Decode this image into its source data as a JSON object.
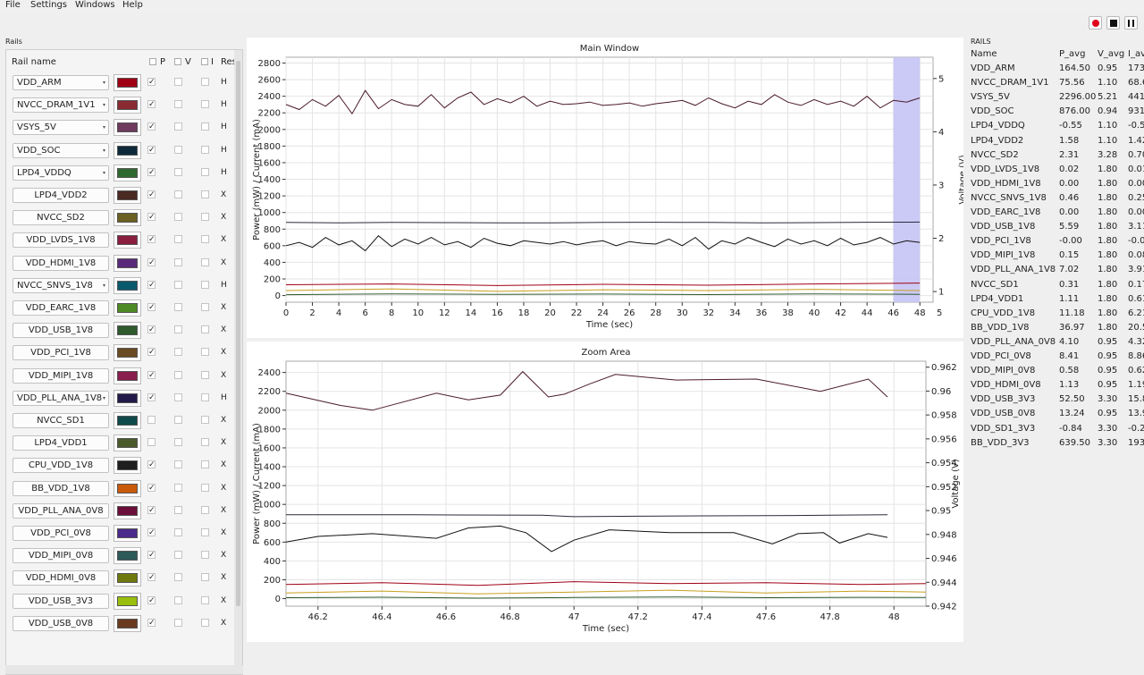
{
  "menu": [
    "File",
    "Settings",
    "Windows",
    "Help"
  ],
  "toolbar": {
    "buttons": [
      "record",
      "stop",
      "pause"
    ]
  },
  "rails_panel": {
    "title": "Rails",
    "headers": {
      "name": "Rail name",
      "p": "P",
      "v": "V",
      "i": "I",
      "res": "Res"
    },
    "rows": [
      {
        "name": "VDD_ARM",
        "dropdown": true,
        "color": "#a00014",
        "p": true,
        "res": "H"
      },
      {
        "name": "NVCC_DRAM_1V1",
        "dropdown": true,
        "color": "#8a2a32",
        "p": true,
        "res": "H"
      },
      {
        "name": "VSYS_5V",
        "dropdown": true,
        "color": "#6e3a5e",
        "p": true,
        "res": "H"
      },
      {
        "name": "VDD_SOC",
        "dropdown": true,
        "color": "#0e2a3a",
        "p": true,
        "res": "H"
      },
      {
        "name": "LPD4_VDDQ",
        "dropdown": true,
        "color": "#2e6a30",
        "p": true,
        "res": "H"
      },
      {
        "name": "LPD4_VDD2",
        "dropdown": false,
        "color": "#4a2a22",
        "p": true,
        "res": "X"
      },
      {
        "name": "NVCC_SD2",
        "dropdown": false,
        "color": "#6b5f22",
        "p": true,
        "res": "X"
      },
      {
        "name": "VDD_LVDS_1V8",
        "dropdown": false,
        "color": "#8a1e3e",
        "p": true,
        "res": "X"
      },
      {
        "name": "VDD_HDMI_1V8",
        "dropdown": false,
        "color": "#5a2a7a",
        "p": true,
        "res": "X"
      },
      {
        "name": "NVCC_SNVS_1V8",
        "dropdown": true,
        "color": "#0a5a6e",
        "p": true,
        "res": "H"
      },
      {
        "name": "VDD_EARC_1V8",
        "dropdown": false,
        "color": "#4e8a26",
        "p": true,
        "res": "X"
      },
      {
        "name": "VDD_USB_1V8",
        "dropdown": false,
        "color": "#2e5a2e",
        "p": true,
        "res": "X"
      },
      {
        "name": "VDD_PCI_1V8",
        "dropdown": false,
        "color": "#6a4a22",
        "p": true,
        "res": "X"
      },
      {
        "name": "VDD_MIPI_1V8",
        "dropdown": false,
        "color": "#8a1e4e",
        "p": true,
        "res": "X"
      },
      {
        "name": "VDD_PLL_ANA_1V8",
        "dropdown": true,
        "color": "#241a4a",
        "p": true,
        "res": "H"
      },
      {
        "name": "NVCC_SD1",
        "dropdown": false,
        "color": "#0e4a4a",
        "p": false,
        "res": "X"
      },
      {
        "name": "LPD4_VDD1",
        "dropdown": false,
        "color": "#4a5a2a",
        "p": false,
        "res": "X"
      },
      {
        "name": "CPU_VDD_1V8",
        "dropdown": false,
        "color": "#1e1e1e",
        "p": true,
        "res": "X"
      },
      {
        "name": "BB_VDD_1V8",
        "dropdown": false,
        "color": "#c85a0a",
        "p": true,
        "res": "X"
      },
      {
        "name": "VDD_PLL_ANA_0V8",
        "dropdown": false,
        "color": "#6a0e3a",
        "p": true,
        "res": "X"
      },
      {
        "name": "VDD_PCI_0V8",
        "dropdown": false,
        "color": "#4a2a8a",
        "p": true,
        "res": "X"
      },
      {
        "name": "VDD_MIPI_0V8",
        "dropdown": false,
        "color": "#2e5a5a",
        "p": true,
        "res": "X"
      },
      {
        "name": "VDD_HDMI_0V8",
        "dropdown": false,
        "color": "#6e7a0e",
        "p": true,
        "res": "X"
      },
      {
        "name": "VDD_USB_3V3",
        "dropdown": false,
        "color": "#9abe0e",
        "p": true,
        "res": "X"
      },
      {
        "name": "VDD_USB_0V8",
        "dropdown": false,
        "color": "#6a3a1e",
        "p": true,
        "res": "X"
      }
    ]
  },
  "main_chart": {
    "title": "Main Window",
    "xlabel": "Time (sec)",
    "ylabel": "Power (mW) / Current (mA)",
    "y2label": "Voltage (V)",
    "xticks": [
      "0",
      "2",
      "4",
      "6",
      "8",
      "10",
      "12",
      "14",
      "16",
      "18",
      "20",
      "22",
      "24",
      "26",
      "28",
      "30",
      "32",
      "34",
      "36",
      "38",
      "40",
      "42",
      "44",
      "46",
      "48"
    ],
    "yticks": [
      "0",
      "200",
      "400",
      "600",
      "800",
      "1000",
      "1200",
      "1400",
      "1600",
      "1800",
      "2000",
      "2200",
      "2400",
      "2600",
      "2800"
    ],
    "y2ticks": [
      "1",
      "2",
      "3",
      "4",
      "5"
    ],
    "x2_edge_tick": "5"
  },
  "zoom_chart": {
    "title": "Zoom Area",
    "xlabel": "Time (sec)",
    "ylabel": "Power (mW) / Current (mA)",
    "y2label": "Voltage (V)",
    "xticks": [
      "46.2",
      "46.4",
      "46.6",
      "46.8",
      "47",
      "47.2",
      "47.4",
      "47.6",
      "47.8",
      "48"
    ],
    "yticks": [
      "0",
      "200",
      "400",
      "600",
      "800",
      "1000",
      "1200",
      "1400",
      "1600",
      "1800",
      "2000",
      "2200",
      "2400"
    ],
    "y2ticks": [
      "0.942",
      "0.944",
      "0.946",
      "0.948",
      "0.95",
      "0.952",
      "0.954",
      "0.956",
      "0.958",
      "0.96",
      "0.962"
    ]
  },
  "chart_data": [
    {
      "type": "line",
      "title": "Main Window",
      "xlabel": "Time (sec)",
      "ylabel": "Power (mW) / Current (mA)",
      "y2label": "Voltage (V)",
      "xlim": [
        0,
        49
      ],
      "ylim": [
        -80,
        2870
      ],
      "y2lim": [
        0.8,
        5.4
      ],
      "grid": true,
      "highlight_region": [
        46,
        48
      ],
      "series": [
        {
          "x": [
            0,
            1,
            2,
            3,
            4,
            5,
            6,
            7,
            8,
            9,
            10,
            11,
            12,
            13,
            14,
            15,
            16,
            17,
            18,
            19,
            20,
            21,
            22,
            23,
            24,
            25,
            26,
            27,
            28,
            29,
            30,
            31,
            32,
            33,
            34,
            35,
            36,
            37,
            38,
            39,
            40,
            41,
            42,
            43,
            44,
            45,
            46,
            47,
            48
          ],
          "values": [
            2300,
            2240,
            2360,
            2280,
            2410,
            2190,
            2470,
            2250,
            2360,
            2300,
            2280,
            2420,
            2260,
            2380,
            2450,
            2300,
            2370,
            2320,
            2400,
            2280,
            2340,
            2300,
            2310,
            2330,
            2290,
            2300,
            2320,
            2280,
            2310,
            2330,
            2350,
            2290,
            2380,
            2310,
            2260,
            2340,
            2300,
            2420,
            2330,
            2290,
            2360,
            2300,
            2340,
            2280,
            2400,
            2260,
            2350,
            2330,
            2380
          ]
        },
        {
          "x": [
            0,
            4,
            8,
            12,
            16,
            20,
            24,
            28,
            32,
            36,
            40,
            44,
            48
          ],
          "values": [
            880,
            875,
            880,
            878,
            876,
            875,
            880,
            882,
            880,
            876,
            878,
            882,
            885
          ]
        },
        {
          "x": [
            0,
            1,
            2,
            3,
            4,
            5,
            6,
            7,
            8,
            9,
            10,
            11,
            12,
            13,
            14,
            15,
            16,
            17,
            18,
            19,
            20,
            21,
            22,
            23,
            24,
            25,
            26,
            27,
            28,
            29,
            30,
            31,
            32,
            33,
            34,
            35,
            36,
            37,
            38,
            39,
            40,
            41,
            42,
            43,
            44,
            45,
            46,
            47,
            48
          ],
          "values": [
            600,
            640,
            580,
            700,
            610,
            660,
            540,
            720,
            590,
            680,
            620,
            700,
            610,
            650,
            580,
            690,
            630,
            600,
            660,
            640,
            620,
            650,
            610,
            640,
            660,
            600,
            650,
            630,
            620,
            680,
            600,
            700,
            560,
            660,
            620,
            700,
            640,
            590,
            680,
            620,
            660,
            600,
            690,
            610,
            640,
            700,
            620,
            660,
            640
          ]
        },
        {
          "x": [
            0,
            8,
            16,
            24,
            32,
            40,
            48
          ],
          "values": [
            130,
            140,
            120,
            135,
            125,
            140,
            150
          ]
        },
        {
          "x": [
            0,
            8,
            16,
            24,
            32,
            40,
            48
          ],
          "values": [
            60,
            80,
            50,
            70,
            60,
            75,
            60
          ]
        },
        {
          "x": [
            0,
            8,
            16,
            24,
            32,
            40,
            48
          ],
          "values": [
            10,
            20,
            15,
            18,
            12,
            20,
            15
          ]
        }
      ]
    },
    {
      "type": "line",
      "title": "Zoom Area",
      "xlabel": "Time (sec)",
      "ylabel": "Power (mW) / Current (mA)",
      "y2label": "Voltage (V)",
      "xlim": [
        46.1,
        48.1
      ],
      "ylim": [
        -80,
        2520
      ],
      "y2lim": [
        0.942,
        0.9625
      ],
      "grid": true,
      "series": [
        {
          "x": [
            46.1,
            46.27,
            46.37,
            46.57,
            46.67,
            46.77,
            46.84,
            46.92,
            46.97,
            47.05,
            47.13,
            47.32,
            47.57,
            47.77,
            47.92,
            47.98
          ],
          "values": [
            2180,
            2050,
            2000,
            2180,
            2110,
            2160,
            2410,
            2140,
            2170,
            2280,
            2380,
            2320,
            2330,
            2200,
            2330,
            2140
          ]
        },
        {
          "x": [
            46.1,
            46.5,
            46.9,
            47.0,
            47.2,
            47.4,
            47.6,
            47.8,
            47.98
          ],
          "values": [
            890,
            890,
            885,
            870,
            875,
            878,
            880,
            885,
            890
          ]
        },
        {
          "x": [
            46.1,
            46.2,
            46.37,
            46.57,
            46.67,
            46.77,
            46.85,
            46.93,
            47.0,
            47.11,
            47.3,
            47.5,
            47.62,
            47.7,
            47.78,
            47.83,
            47.92,
            47.98
          ],
          "values": [
            600,
            660,
            690,
            640,
            750,
            770,
            700,
            500,
            620,
            730,
            700,
            700,
            580,
            690,
            700,
            590,
            690,
            650
          ]
        },
        {
          "x": [
            46.1,
            46.4,
            46.7,
            47.0,
            47.3,
            47.6,
            47.9,
            48.1
          ],
          "values": [
            150,
            170,
            140,
            180,
            160,
            170,
            150,
            160
          ]
        },
        {
          "x": [
            46.1,
            46.4,
            46.7,
            47.0,
            47.3,
            47.6,
            47.9,
            48.1
          ],
          "values": [
            60,
            80,
            50,
            70,
            90,
            60,
            80,
            70
          ]
        },
        {
          "x": [
            46.1,
            46.4,
            46.7,
            47.0,
            47.3,
            47.6,
            47.9,
            48.1
          ],
          "values": [
            10,
            15,
            5,
            12,
            18,
            10,
            14,
            12
          ]
        }
      ]
    }
  ],
  "stats": {
    "title": "RAILS",
    "headers": [
      "Name",
      "P_avg",
      "V_avg",
      "I_av"
    ],
    "rows": [
      [
        "VDD_ARM",
        "164.50",
        "0.95",
        "173"
      ],
      [
        "NVCC_DRAM_1V1",
        "75.56",
        "1.10",
        "68.6"
      ],
      [
        "VSYS_5V",
        "2296.00",
        "5.21",
        "441"
      ],
      [
        "VDD_SOC",
        "876.00",
        "0.94",
        "931"
      ],
      [
        "LPD4_VDDQ",
        "-0.55",
        "1.10",
        "-0.5"
      ],
      [
        "LPD4_VDD2",
        "1.58",
        "1.10",
        "1.42"
      ],
      [
        "NVCC_SD2",
        "2.31",
        "3.28",
        "0.70"
      ],
      [
        "VDD_LVDS_1V8",
        "0.02",
        "1.80",
        "0.01"
      ],
      [
        "VDD_HDMI_1V8",
        "0.00",
        "1.80",
        "0.00"
      ],
      [
        "NVCC_SNVS_1V8",
        "0.46",
        "1.80",
        "0.25"
      ],
      [
        "VDD_EARC_1V8",
        "0.00",
        "1.80",
        "0.00"
      ],
      [
        "VDD_USB_1V8",
        "5.59",
        "1.80",
        "3.11"
      ],
      [
        "VDD_PCI_1V8",
        "-0.00",
        "1.80",
        "-0.0"
      ],
      [
        "VDD_MIPI_1V8",
        "0.15",
        "1.80",
        "0.08"
      ],
      [
        "VDD_PLL_ANA_1V8",
        "7.02",
        "1.80",
        "3.91"
      ],
      [
        "NVCC_SD1",
        "0.31",
        "1.80",
        "0.17"
      ],
      [
        "LPD4_VDD1",
        "1.11",
        "1.80",
        "0.61"
      ],
      [
        "CPU_VDD_1V8",
        "11.18",
        "1.80",
        "6.21"
      ],
      [
        "BB_VDD_1V8",
        "36.97",
        "1.80",
        "20.5"
      ],
      [
        "VDD_PLL_ANA_0V8",
        "4.10",
        "0.95",
        "4.32"
      ],
      [
        "VDD_PCI_0V8",
        "8.41",
        "0.95",
        "8.86"
      ],
      [
        "VDD_MIPI_0V8",
        "0.58",
        "0.95",
        "0.62"
      ],
      [
        "VDD_HDMI_0V8",
        "1.13",
        "0.95",
        "1.19"
      ],
      [
        "VDD_USB_3V3",
        "52.50",
        "3.30",
        "15.8"
      ],
      [
        "VDD_USB_0V8",
        "13.24",
        "0.95",
        "13.9"
      ],
      [
        "VDD_SD1_3V3",
        "-0.84",
        "3.30",
        "-0.2"
      ],
      [
        "BB_VDD_3V3",
        "639.50",
        "3.30",
        "193"
      ]
    ]
  }
}
